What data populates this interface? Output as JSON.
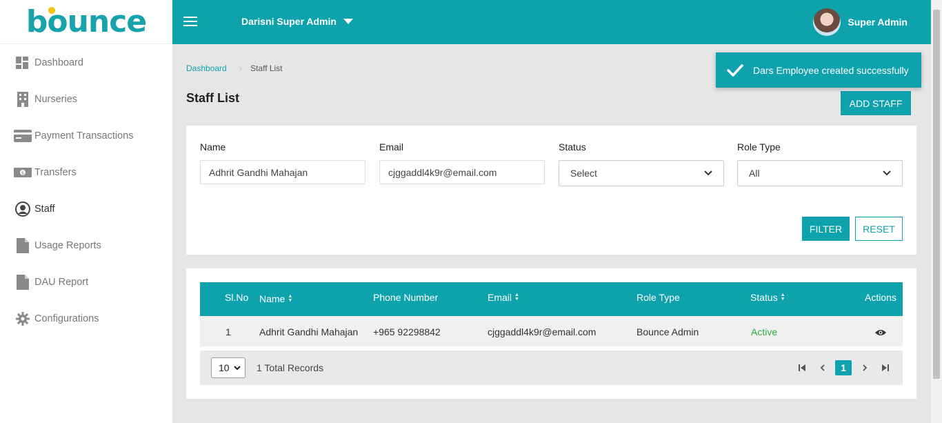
{
  "brand": {
    "logo_text": "bounce",
    "accent": "#0ea2ac",
    "logo_dot": "#f1c40f"
  },
  "sidebar": {
    "items": [
      {
        "label": "Dashboard",
        "icon": "dashboard-icon"
      },
      {
        "label": "Nurseries",
        "icon": "building-icon"
      },
      {
        "label": "Payment Transactions",
        "icon": "credit-card-icon"
      },
      {
        "label": "Transfers",
        "icon": "money-icon"
      },
      {
        "label": "Staff",
        "icon": "user-circle-icon",
        "active": true
      },
      {
        "label": "Usage Reports",
        "icon": "file-icon"
      },
      {
        "label": "DAU Report",
        "icon": "file-icon"
      },
      {
        "label": "Configurations",
        "icon": "gear-icon"
      }
    ]
  },
  "header": {
    "org_name": "Darisni Super Admin",
    "user_name": "Super Admin"
  },
  "breadcrumb": {
    "home": "Dashboard",
    "current": "Staff List"
  },
  "page": {
    "title": "Staff List",
    "add_button": "ADD STAFF"
  },
  "toast": {
    "message": "Dars Employee created successfully"
  },
  "filters": {
    "name": {
      "label": "Name",
      "value": "Adhrit Gandhi Mahajan"
    },
    "email": {
      "label": "Email",
      "value": "cjggaddl4k9r@email.com"
    },
    "status": {
      "label": "Status",
      "value": "Select"
    },
    "role_type": {
      "label": "Role Type",
      "value": "All"
    },
    "filter_button": "FILTER",
    "reset_button": "RESET"
  },
  "table": {
    "columns": [
      "Sl.No",
      "Name",
      "Phone Number",
      "Email",
      "Role Type",
      "Status",
      "Actions"
    ],
    "rows": [
      {
        "slno": "1",
        "name": "Adhrit Gandhi Mahajan",
        "phone": "+965 92298842",
        "email": "cjggaddl4k9r@email.com",
        "role": "Bounce Admin",
        "status": "Active"
      }
    ]
  },
  "pagination": {
    "page_size": "10",
    "total_records": "1 Total Records",
    "current_page": "1"
  }
}
